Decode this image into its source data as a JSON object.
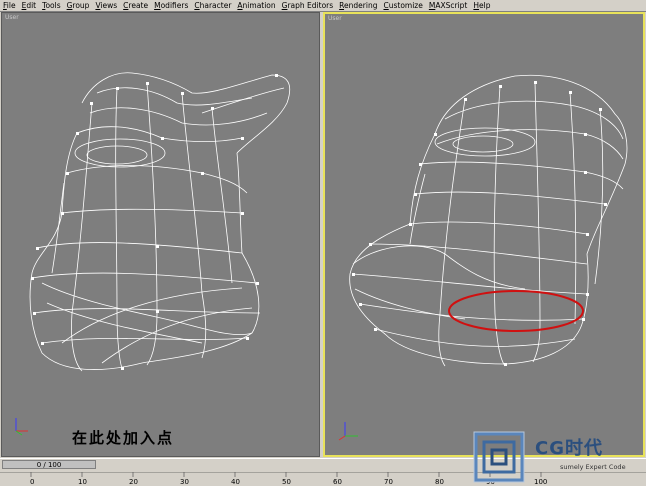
{
  "menu": [
    "File",
    "Edit",
    "Tools",
    "Group",
    "Views",
    "Create",
    "Modifiers",
    "Character",
    "Animation",
    "Graph Editors",
    "Rendering",
    "Customize",
    "MAXScript",
    "Help"
  ],
  "viewports": {
    "left": {
      "label": "User"
    },
    "right": {
      "label": "User"
    }
  },
  "annotation": "在此处加入点",
  "time_slider": {
    "text": "0 / 100"
  },
  "ruler_ticks": [
    "0",
    "10",
    "20",
    "30",
    "40",
    "50",
    "60",
    "70",
    "80",
    "90",
    "100"
  ],
  "watermark": {
    "brand": "CG时代",
    "sub": "sumely Expert Code"
  },
  "colors": {
    "viewport_bg": "#7e7e7e",
    "wire": "#ffffff",
    "active_border": "#e8e25a",
    "highlight_ellipse": "#d01010"
  },
  "axis_icons": [
    "axis-tripod-icon",
    "axis-tripod-icon"
  ]
}
